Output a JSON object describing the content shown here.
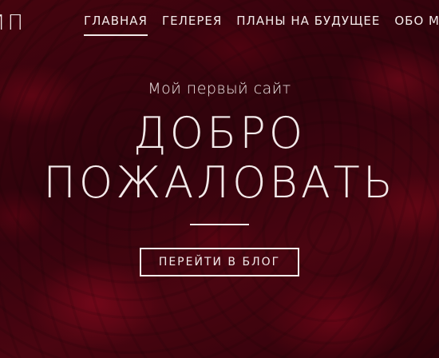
{
  "header": {
    "logo_text": "ТИП"
  },
  "nav": {
    "items": [
      {
        "label": "ГЛАВНАЯ",
        "active": true
      },
      {
        "label": "ГЕЛЕРЕЯ"
      },
      {
        "label": "ПЛАНЫ НА БУДУЩЕЕ"
      },
      {
        "label": "ОБО МНЕ"
      }
    ]
  },
  "hero": {
    "subtitle": "Мой первый сайт",
    "headline_line1": "ДОБРО",
    "headline_line2": "ПОЖАЛОВАТЬ",
    "cta_label": "ПЕРЕЙТИ В БЛОГ"
  },
  "colors": {
    "text": "#f3eaea",
    "background": "#5a0613"
  }
}
